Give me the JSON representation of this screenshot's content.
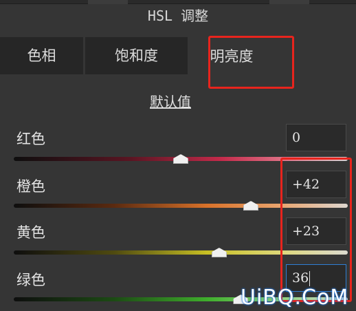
{
  "panel": {
    "title": "HSL 调整",
    "tabs": [
      {
        "label": "色相",
        "active": false
      },
      {
        "label": "饱和度",
        "active": false
      },
      {
        "label": "明亮度",
        "active": true
      }
    ],
    "reset_label": "默认值"
  },
  "sliders": [
    {
      "label": "红色",
      "value": "0",
      "level_percent": 50,
      "focused": false
    },
    {
      "label": "橙色",
      "value": "+42",
      "level_percent": 71,
      "focused": false
    },
    {
      "label": "黄色",
      "value": "+23",
      "level_percent": 61.5,
      "focused": false
    },
    {
      "label": "绿色",
      "value": "36",
      "level_percent": 68,
      "focused": true
    }
  ],
  "colors": {
    "highlight": "#e8241d",
    "focus_border": "#2f7fd6",
    "red": "#c42a4a",
    "orange": "#d9722a",
    "yellow": "#c8c024",
    "green": "#3fae2c"
  },
  "watermark": "UiBQ.CoM"
}
